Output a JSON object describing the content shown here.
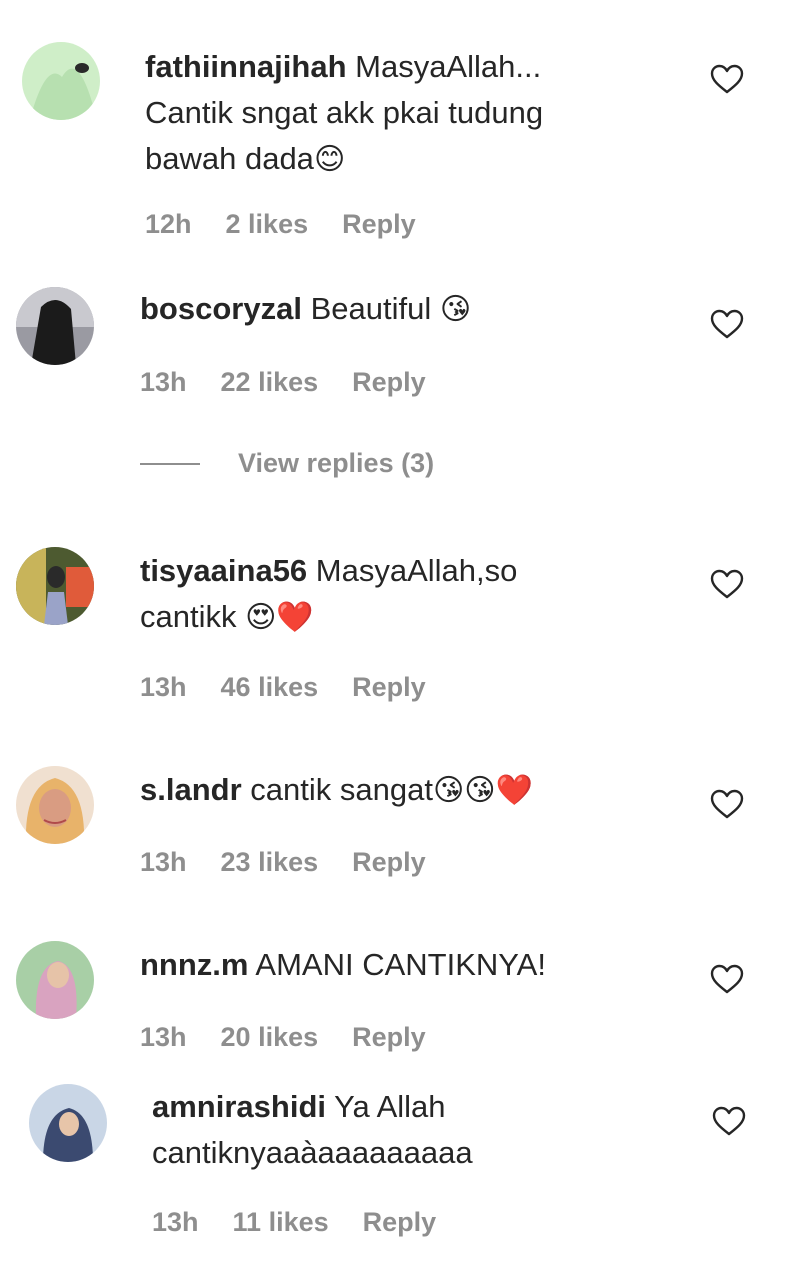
{
  "comments": [
    {
      "username": "fathiinnajihah",
      "text_lines": [
        "MasyaAllah...",
        "Cantik sngat akk pkai tudung",
        "bawah dada"
      ],
      "emojis": "😊",
      "time": "12h",
      "likes": "2 likes",
      "reply": "Reply",
      "avatar_color": "#cfeec8"
    },
    {
      "username": "boscoryzal",
      "text_lines": [
        "Beautiful"
      ],
      "emojis": "😘",
      "time": "13h",
      "likes": "22 likes",
      "reply": "Reply",
      "view_replies": "View replies (3)",
      "avatar_color": "#7a7a80"
    },
    {
      "username": "tisyaaina56",
      "text_lines": [
        "MasyaAllah,so",
        "cantikk"
      ],
      "emojis": "😍❤️",
      "time": "13h",
      "likes": "46 likes",
      "reply": "Reply",
      "avatar_color": "#5b6a3a"
    },
    {
      "username": "s.landr",
      "text_lines": [
        "cantik sangat"
      ],
      "emojis": "😘😘❤️",
      "time": "13h",
      "likes": "23 likes",
      "reply": "Reply",
      "avatar_color": "#d9a06a"
    },
    {
      "username": "nnnz.m",
      "text_lines": [
        "AMANI CANTIKNYA!"
      ],
      "emojis": "",
      "time": "13h",
      "likes": "20 likes",
      "reply": "Reply",
      "avatar_color": "#9fc7a2"
    },
    {
      "username": "amnirashidi",
      "text_lines": [
        "Ya Allah",
        "cantiknyaaàaaaaaaaaa"
      ],
      "emojis": "",
      "time": "13h",
      "likes": "11 likes",
      "reply": "Reply",
      "avatar_color": "#b9c8dc"
    }
  ],
  "icons": {
    "like": "heart-outline-icon"
  }
}
